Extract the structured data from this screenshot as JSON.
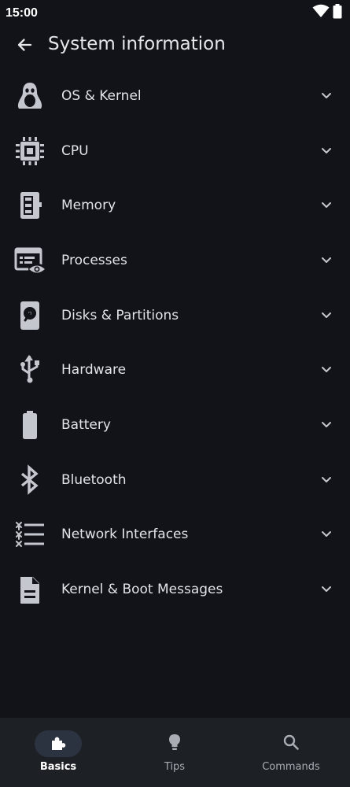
{
  "status_bar": {
    "time": "15:00",
    "wifi_icon": "wifi-icon",
    "battery_icon": "battery-icon"
  },
  "header": {
    "back_icon": "arrow-left-icon",
    "title": "System information"
  },
  "list": {
    "items": [
      {
        "label": "OS & Kernel",
        "icon": "linux-penguin-icon"
      },
      {
        "label": "CPU",
        "icon": "cpu-chip-icon"
      },
      {
        "label": "Memory",
        "icon": "memory-icon"
      },
      {
        "label": "Processes",
        "icon": "processes-icon"
      },
      {
        "label": "Disks & Partitions",
        "icon": "hard-disk-icon"
      },
      {
        "label": "Hardware",
        "icon": "usb-icon"
      },
      {
        "label": "Battery",
        "icon": "battery-icon"
      },
      {
        "label": "Bluetooth",
        "icon": "bluetooth-icon"
      },
      {
        "label": "Network Interfaces",
        "icon": "network-list-icon"
      },
      {
        "label": "Kernel & Boot Messages",
        "icon": "document-icon"
      }
    ],
    "chevron_icon": "chevron-down-icon"
  },
  "bottom_nav": {
    "items": [
      {
        "label": "Basics",
        "icon": "puzzle-icon",
        "active": true
      },
      {
        "label": "Tips",
        "icon": "lightbulb-icon",
        "active": false
      },
      {
        "label": "Commands",
        "icon": "search-icon",
        "active": false
      }
    ]
  },
  "colors": {
    "background": "#111318",
    "nav_background": "#1d2025",
    "active_pill": "#2c3340",
    "icon": "#c4c7ce",
    "text": "#e3e3e8"
  }
}
